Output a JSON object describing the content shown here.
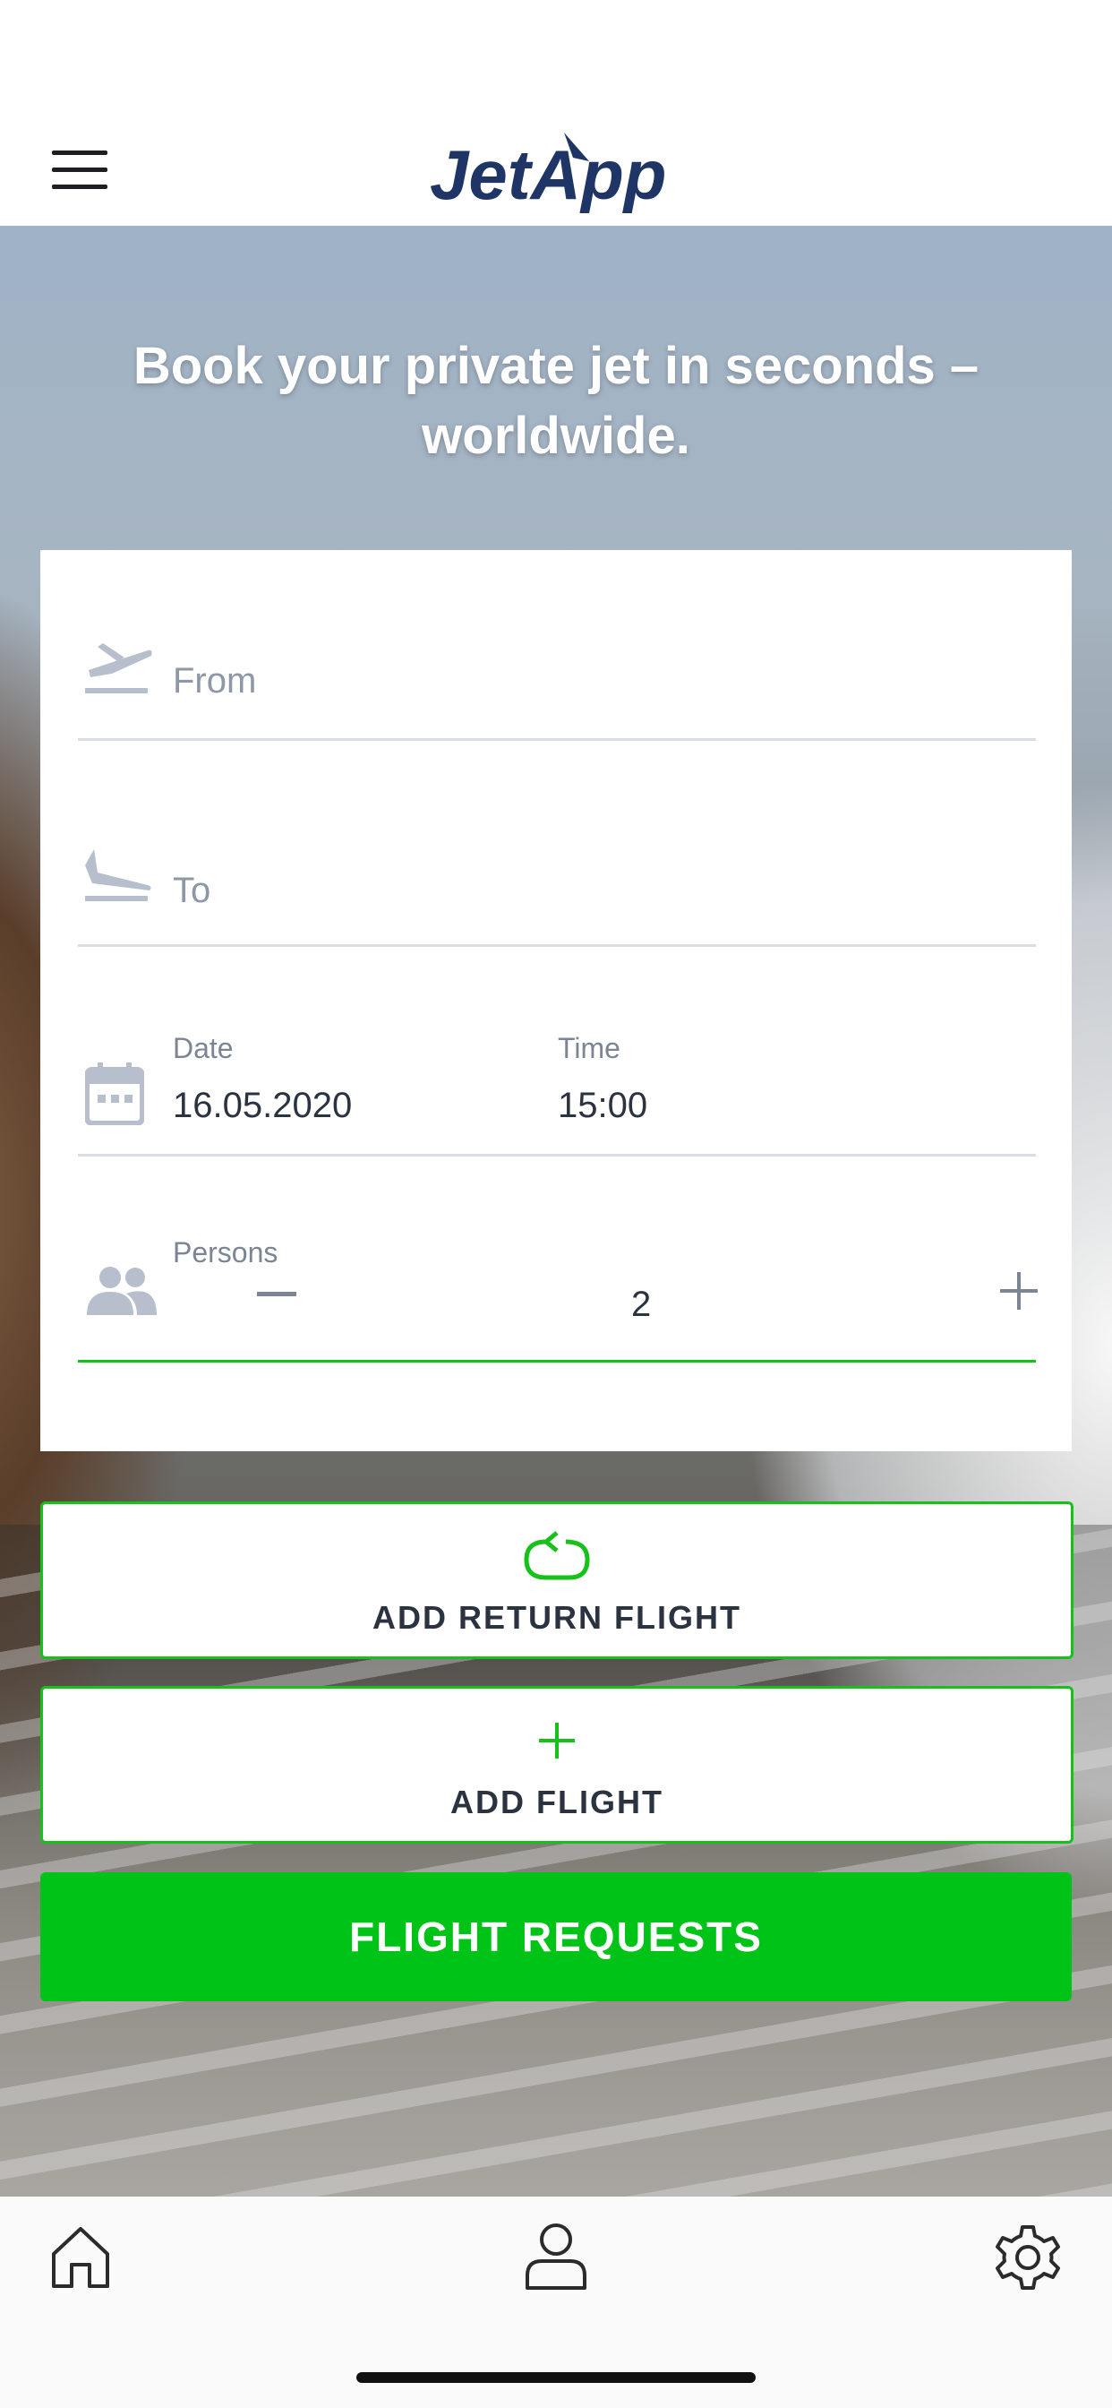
{
  "header": {
    "logo_text": "JetApp",
    "menu_icon": "hamburger-menu-icon"
  },
  "hero": {
    "title_line1": "Book your private jet in seconds –",
    "title_line2": "worldwide."
  },
  "form": {
    "from": {
      "placeholder": "From",
      "icon": "takeoff-icon"
    },
    "to": {
      "placeholder": "To",
      "icon": "landing-icon"
    },
    "date": {
      "label": "Date",
      "value": "16.05.2020",
      "icon": "calendar-icon"
    },
    "time": {
      "label": "Time",
      "value": "15:00"
    },
    "persons": {
      "label": "Persons",
      "value": "2",
      "decrement": "−",
      "increment": "+",
      "icon": "people-icon"
    }
  },
  "buttons": {
    "add_return_flight": "ADD RETURN FLIGHT",
    "add_flight": "ADD FLIGHT",
    "flight_requests": "FLIGHT REQUESTS"
  },
  "bottom_nav": {
    "items": [
      {
        "name": "home",
        "icon": "home-icon"
      },
      {
        "name": "profile",
        "icon": "user-icon"
      },
      {
        "name": "settings",
        "icon": "gear-icon"
      }
    ]
  },
  "colors": {
    "accent": "#00c318",
    "brand_navy": "#1f3566",
    "icon_gray": "#b8bfcc"
  }
}
